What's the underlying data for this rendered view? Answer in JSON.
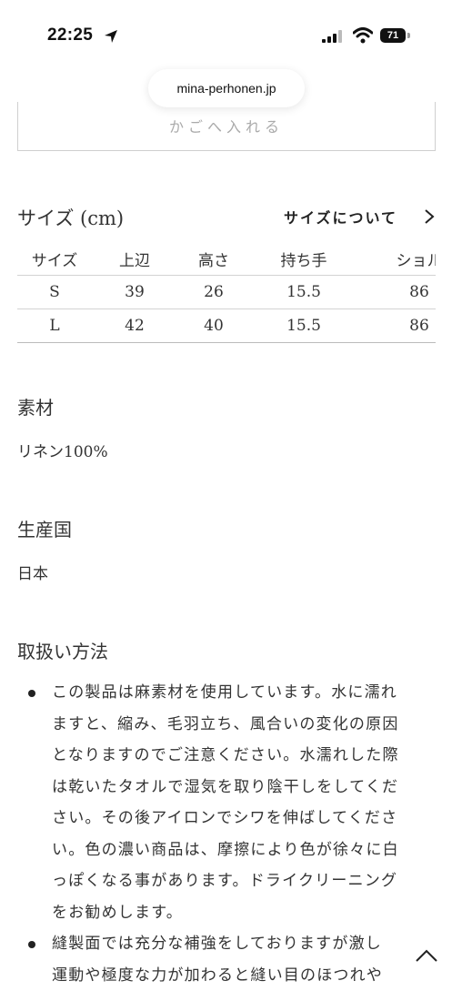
{
  "status": {
    "time": "22:25",
    "battery": "71"
  },
  "browser": {
    "url": "mina-perhonen.jp"
  },
  "cart": {
    "label": "かごへ入れる"
  },
  "size_section": {
    "heading": "サイズ (cm)",
    "link": "サイズについて",
    "columns": [
      "サイズ",
      "上辺",
      "高さ",
      "持ち手",
      "ショル"
    ],
    "rows": [
      [
        "S",
        "39",
        "26",
        "15.5",
        "86"
      ],
      [
        "L",
        "42",
        "40",
        "15.5",
        "86"
      ]
    ]
  },
  "material": {
    "title": "素材",
    "value": "リネン100%"
  },
  "origin": {
    "title": "生産国",
    "value": "日本"
  },
  "care": {
    "title": "取扱い方法",
    "items": [
      {
        "lines": [
          "この製品は麻素材を使用しています。水に濡れ",
          "ますと、縮み、毛羽立ち、風合いの変化の原因",
          "となりますのでご注意ください。水濡れした際",
          "は乾いたタオルで湿気を取り陰干しをしてくだ",
          "さい。その後アイロンでシワを伸ばしてくださ",
          "い。色の濃い商品は、摩擦により色が徐々に白",
          "っぽくなる事があります。ドライクリーニング",
          "をお勧めします。"
        ]
      },
      {
        "lines": [
          "縫製面では充分な補強をしておりますが激し",
          "運動や極度な力が加わると縫い目のほつれや"
        ]
      }
    ]
  }
}
